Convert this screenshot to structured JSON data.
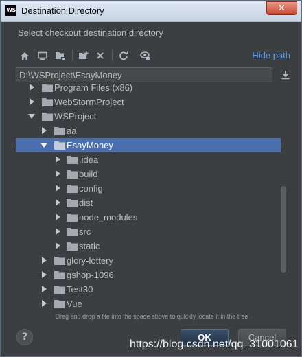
{
  "window": {
    "app_icon_text": "WS",
    "title": "Destination Directory",
    "close_glyph": "✕"
  },
  "subtitle": "Select checkout destination directory",
  "toolbar": {
    "icons": [
      "home-icon",
      "desktop-icon",
      "project-folder-icon",
      "new-folder-icon",
      "delete-icon",
      "refresh-icon",
      "show-hidden-icon"
    ],
    "hide_path_label": "Hide path"
  },
  "path": {
    "value": "D:\\WSProject\\EsayMoney"
  },
  "tree": {
    "rows": [
      {
        "label": "Program Files (x86)",
        "expanded": false
      },
      {
        "label": "WebStormProject",
        "expanded": false
      },
      {
        "label": "WSProject",
        "expanded": true
      },
      {
        "label": "aa",
        "expanded": false
      },
      {
        "label": "EsayMoney",
        "expanded": true,
        "selected": true
      },
      {
        "label": ".idea",
        "expanded": false
      },
      {
        "label": "build",
        "expanded": false
      },
      {
        "label": "config",
        "expanded": false
      },
      {
        "label": "dist",
        "expanded": false
      },
      {
        "label": "node_modules",
        "expanded": false
      },
      {
        "label": "src",
        "expanded": false
      },
      {
        "label": "static",
        "expanded": false
      },
      {
        "label": "glory-lottery",
        "expanded": false
      },
      {
        "label": "gshop-1096",
        "expanded": false
      },
      {
        "label": "Test30",
        "expanded": false
      },
      {
        "label": "Vue",
        "expanded": false
      }
    ]
  },
  "hint": "Drag and drop a file into the space above to quickly locate it in the tree",
  "buttons": {
    "help": "?",
    "ok": "OK",
    "cancel": "Cancel"
  },
  "watermark": "https://blog.csdn.net/qq_31001061",
  "colors": {
    "dialog_bg": "#3c3f41",
    "selection": "#4b6eaf",
    "link": "#589df6",
    "text": "#bbbbbb"
  }
}
